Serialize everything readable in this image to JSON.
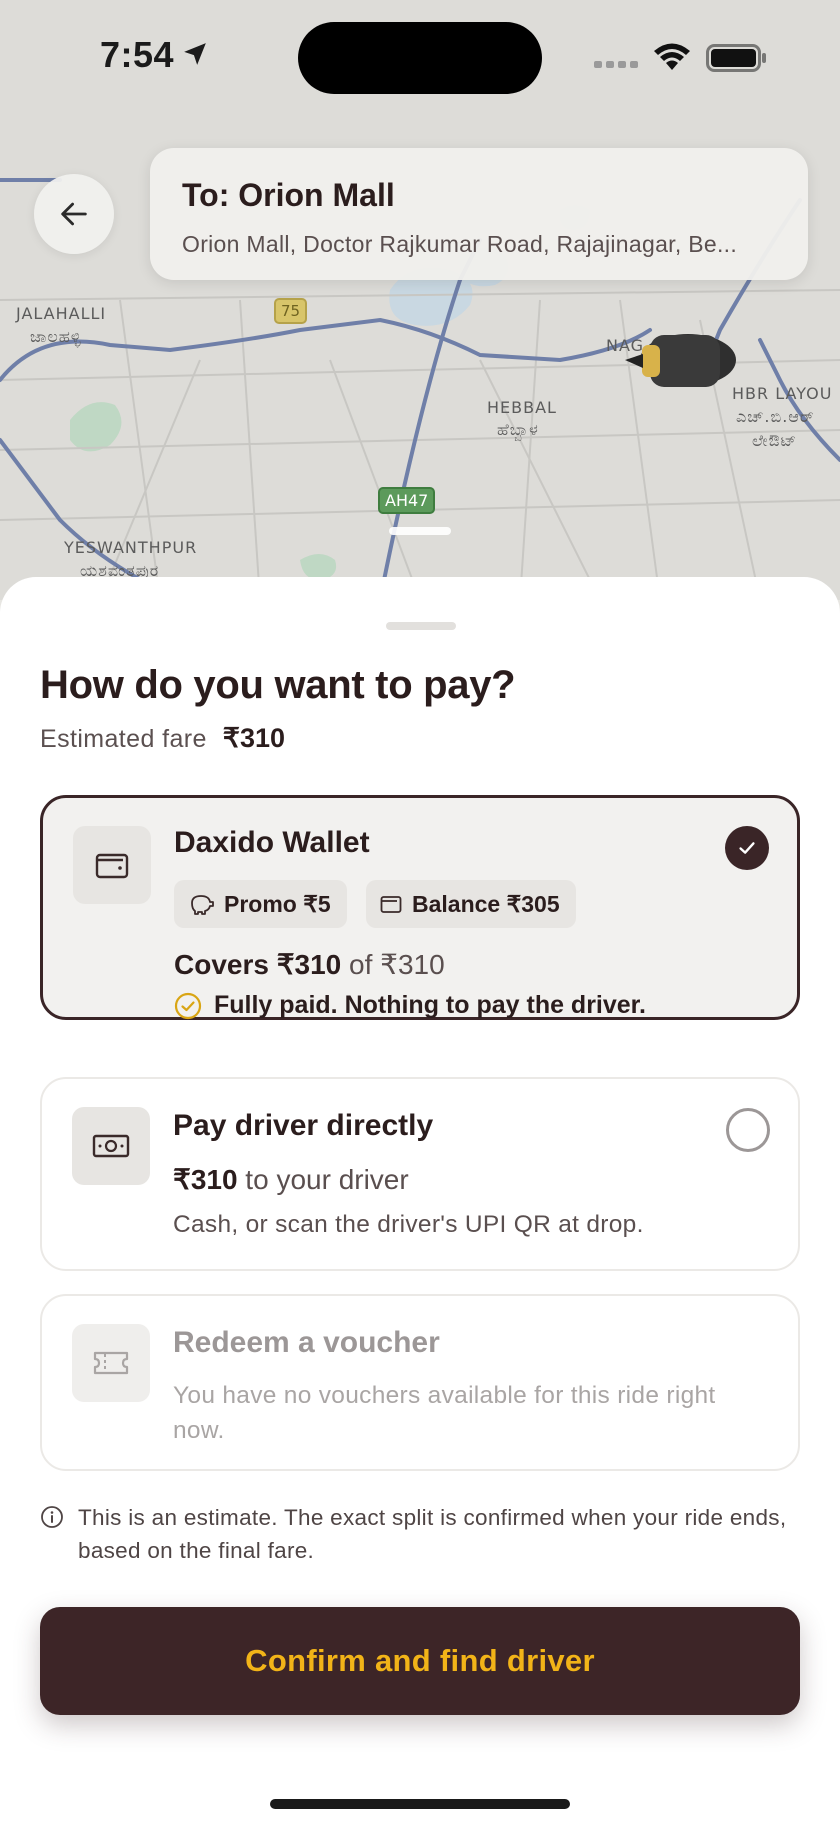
{
  "status_bar": {
    "time": "7:54"
  },
  "map": {
    "labels": [
      {
        "id": "jalahalli",
        "text": "JALAHALLI"
      },
      {
        "id": "jalahalli-kn",
        "text": "ಜಾಲಹಳ್ಳಿ"
      },
      {
        "id": "hebbal",
        "text": "HEBBAL"
      },
      {
        "id": "hebbal-kn",
        "text": "ಹೆಬ್ಬಾಳ"
      },
      {
        "id": "yeswanthpur",
        "text": "YESWANTHPUR"
      },
      {
        "id": "yeswanthpur-kn",
        "text": "ಯಶವಂತಪುರ"
      },
      {
        "id": "nag",
        "text": "NAG"
      },
      {
        "id": "hbr",
        "text": "HBR LAYOU"
      },
      {
        "id": "hbr-kn-1",
        "text": "ಎಚ್.ಬಿ.ಆರ್"
      },
      {
        "id": "hbr-kn-2",
        "text": "ಲೇಔಟ್"
      }
    ],
    "shields": {
      "nh75": "75",
      "ah47": "AH47"
    }
  },
  "destination": {
    "title": "To: Orion Mall",
    "address": "Orion Mall, Doctor Rajkumar Road, Rajajinagar, Be..."
  },
  "sheet": {
    "title": "How do you want to pay?",
    "fare_label": "Estimated fare",
    "fare_value": "₹310"
  },
  "options": {
    "wallet": {
      "title": "Daxido Wallet",
      "promo_chip": "Promo ₹5",
      "balance_chip": "Balance ₹305",
      "covers_bold": "Covers ₹310",
      "covers_rest": " of ₹310",
      "paid_text": "Fully paid. Nothing to pay the driver.",
      "selected": true
    },
    "driver": {
      "title": "Pay driver directly",
      "amount_bold": "₹310",
      "amount_rest": " to your driver",
      "desc": "Cash, or scan the driver's UPI QR at drop.",
      "selected": false
    },
    "voucher": {
      "title": "Redeem a voucher",
      "desc": "You have no vouchers available for this ride right now.",
      "enabled": false
    }
  },
  "note": "This is an estimate. The exact split is confirmed when your ride ends, based on the final fare.",
  "confirm_label": "Confirm and find driver",
  "colors": {
    "accent_dark": "#3d2527",
    "accent_gold": "#f2b418",
    "success_ring": "#d9a514"
  }
}
